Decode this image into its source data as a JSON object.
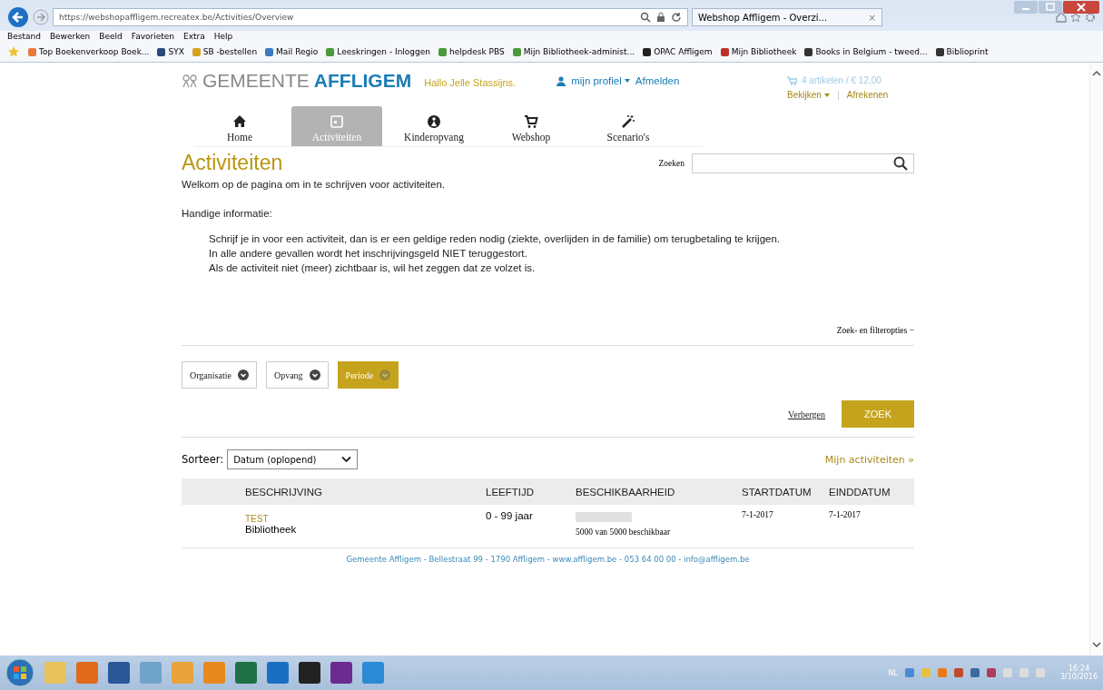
{
  "browser": {
    "address": "https://webshopaffligem.recreatex.be/Activities/Overview",
    "tab_title": "Webshop Affligem - Overzi...",
    "tab_close": "×",
    "menu": [
      "Bestand",
      "Bewerken",
      "Beeld",
      "Favorieten",
      "Extra",
      "Help"
    ],
    "favorites": [
      "Top Boekenverkoop Boek...",
      "SYX",
      "SB -bestellen",
      "Mail Regio",
      "Leeskringen - Inloggen",
      "helpdesk PBS",
      "Mijn Bibliotheek-administ...",
      "OPAC Affligem",
      "Mijn Bibliotheek",
      "Books in Belgium - tweed...",
      "Biblioprint"
    ]
  },
  "header": {
    "logo_light": "GEMEENTE",
    "logo_bold": "AFFLIGEM",
    "greeting": "Hallo Jelle Stassijns.",
    "profile": "mijn profiel",
    "logout": "Afmelden",
    "cart": "4 artikelen / € 12,00",
    "view": "Bekijken",
    "checkout": "Afrekenen"
  },
  "nav": [
    {
      "label": "Home",
      "kind": "home",
      "selected": false
    },
    {
      "label": "Activiteiten",
      "kind": "calendar",
      "selected": true
    },
    {
      "label": "Kinderopvang",
      "kind": "child",
      "selected": false
    },
    {
      "label": "Webshop",
      "kind": "cart",
      "selected": false
    },
    {
      "label": "Scenario's",
      "kind": "wand",
      "selected": false
    }
  ],
  "page": {
    "title": "Activiteiten",
    "search_label": "Zoeken",
    "welcome": "Welkom op de pagina om in te schrijven voor activiteiten.",
    "info_title": "Handige informatie:",
    "info_lines": [
      "Schrijf je in voor een activiteit, dan is er een geldige reden nodig (ziekte, overlijden in de familie) om terugbetaling te krijgen.",
      "In alle andere gevallen wordt het inschrijvingsgeld NIET teruggestort.",
      "Als de activiteit niet (meer) zichtbaar is, wil het zeggen dat ze volzet is."
    ]
  },
  "filters": {
    "toggle": "Zoek- en filteropties −",
    "chips": [
      {
        "label": "Organisatie",
        "selected": false
      },
      {
        "label": "Opvang",
        "selected": false
      },
      {
        "label": "Periode",
        "selected": true
      }
    ],
    "hide": "Verbergen",
    "search_button": "ZOEK"
  },
  "sort": {
    "label": "Sorteer:",
    "value": "Datum (oplopend)",
    "my_activities": "Mijn activiteiten »"
  },
  "table": {
    "columns": [
      "BESCHRIJVING",
      "LEEFTIJD",
      "BESCHIKBAARHEID",
      "STARTDATUM",
      "EINDDATUM"
    ],
    "rows": [
      {
        "title": "TEST",
        "subtitle": "Bibliotheek",
        "age": "0 - 99 jaar",
        "level": 1,
        "availability": "5000 van 5000 beschikbaar",
        "start": "7-1-2017",
        "end": "7-1-2017"
      }
    ]
  },
  "footer": "Gemeente Affligem - Bellestraat 99 - 1790 Affligem - www.affligem.be - 053 64 00 00 - info@affligem.be",
  "taskbar": {
    "apps": [
      {
        "color": "#e8c25a"
      },
      {
        "color": "#e06a1a"
      },
      {
        "color": "#2b5797"
      },
      {
        "color": "#6fa3c8"
      },
      {
        "color": "#e8a33a"
      },
      {
        "color": "#e68a1f"
      },
      {
        "color": "#1e7145"
      },
      {
        "color": "#1b6fc2"
      },
      {
        "color": "#222222"
      },
      {
        "color": "#6a2c8f"
      },
      {
        "color": "#2a8ad4"
      }
    ],
    "lang": "NL",
    "time": "16:24",
    "date": "3/10/2016"
  }
}
